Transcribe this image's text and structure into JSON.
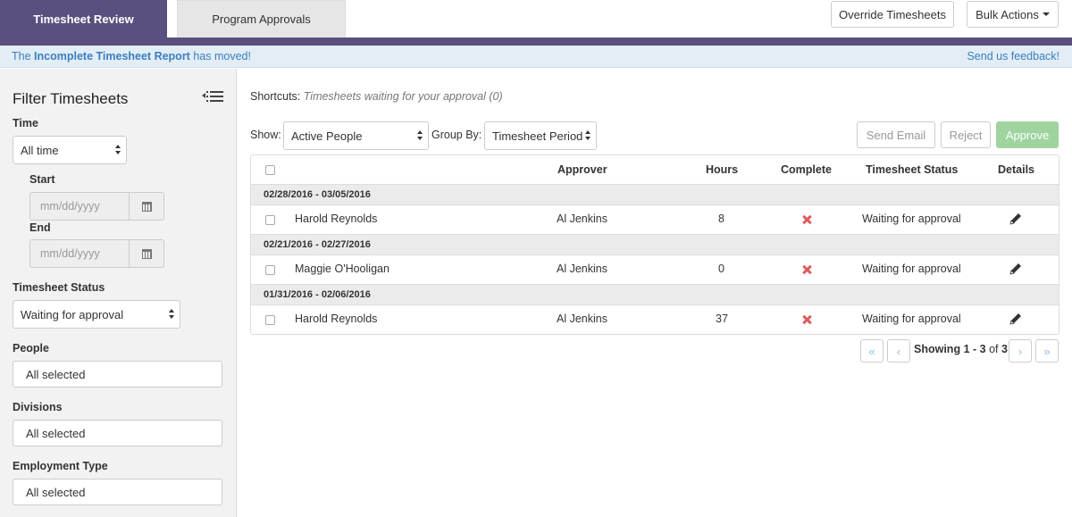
{
  "tabs": [
    {
      "label": "Timesheet Review",
      "active": true
    },
    {
      "label": "Program Approvals",
      "active": false
    }
  ],
  "header_buttons": {
    "override": "Override Timesheets",
    "bulk": "Bulk Actions"
  },
  "notice": {
    "prefix": "The",
    "link": "Incomplete Timesheet Report",
    "suffix": "has moved!",
    "feedback": "Send us feedback!"
  },
  "sidebar": {
    "title": "Filter Timesheets",
    "time_label": "Time",
    "time_value": "All time",
    "start_label": "Start",
    "start_placeholder": "mm/dd/yyyy",
    "end_label": "End",
    "end_placeholder": "mm/dd/yyyy",
    "status_label": "Timesheet Status",
    "status_value": "Waiting for approval",
    "people_label": "People",
    "people_value": "All selected",
    "divisions_label": "Divisions",
    "divisions_value": "All selected",
    "employment_label": "Employment Type",
    "employment_value": "All selected"
  },
  "main": {
    "shortcuts_label": "Shortcuts:",
    "shortcuts_link": "Timesheets waiting for your approval (0)",
    "show_label": "Show:",
    "show_value": "Active People",
    "groupby_label": "Group By:",
    "groupby_value": "Timesheet Period",
    "send_email": "Send Email",
    "reject": "Reject",
    "approve": "Approve"
  },
  "table": {
    "headers": {
      "approver": "Approver",
      "hours": "Hours",
      "complete": "Complete",
      "status": "Timesheet Status",
      "details": "Details"
    },
    "groups": [
      {
        "period": "02/28/2016 - 03/05/2016",
        "rows": [
          {
            "name": "Harold Reynolds",
            "approver": "Al Jenkins",
            "hours": "8",
            "complete": false,
            "status": "Waiting for approval"
          }
        ]
      },
      {
        "period": "02/21/2016 - 02/27/2016",
        "rows": [
          {
            "name": "Maggie O'Hooligan",
            "approver": "Al Jenkins",
            "hours": "0",
            "complete": false,
            "status": "Waiting for approval"
          }
        ]
      },
      {
        "period": "01/31/2016 - 02/06/2016",
        "rows": [
          {
            "name": "Harold Reynolds",
            "approver": "Al Jenkins",
            "hours": "37",
            "complete": false,
            "status": "Waiting for approval"
          }
        ]
      }
    ]
  },
  "pagination": {
    "first": "«",
    "prev": "‹",
    "showing_label": "Showing",
    "range": "1 - 3",
    "of_label": "of",
    "total": "3",
    "next": "›",
    "last": "»"
  },
  "colors": {
    "brand_purple": "#5a4f7e",
    "approve_green": "#9fd49f",
    "incomplete_red": "#e05a5a",
    "link_blue": "#3a7fc1"
  }
}
